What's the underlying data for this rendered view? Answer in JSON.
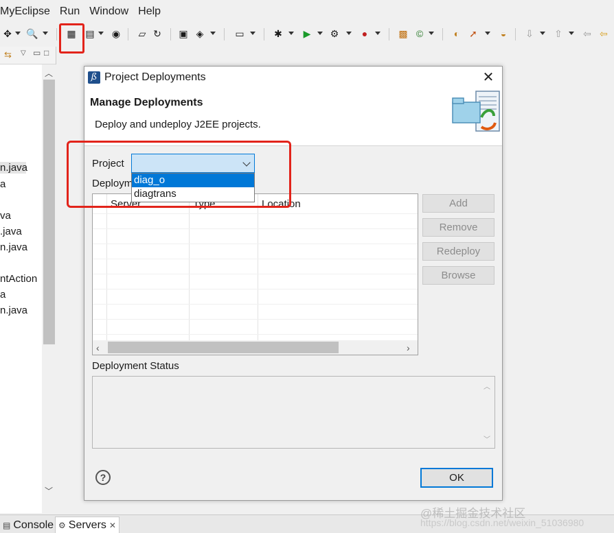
{
  "menubar": {
    "items": [
      "MyEclipse",
      "Run",
      "Window",
      "Help"
    ]
  },
  "left_panel": {
    "items": [
      "n.java",
      "a",
      "va",
      ".java",
      "n.java",
      "ntAction",
      "a",
      "n.java"
    ]
  },
  "bottom_tabs": {
    "console": "Console",
    "servers": "Servers"
  },
  "dialog": {
    "title": "Project Deployments",
    "header_title": "Manage Deployments",
    "header_desc": "Deploy and undeploy J2EE projects.",
    "project_label": "Project",
    "project_options": [
      "diag_o",
      "diagtrans"
    ],
    "project_selected_index": 0,
    "deployments_label": "Deploym",
    "table_columns": [
      "Server",
      "Type",
      "Location"
    ],
    "buttons": {
      "add": "Add",
      "remove": "Remove",
      "redeploy": "Redeploy",
      "browse": "Browse"
    },
    "status_label": "Deployment Status",
    "ok": "OK"
  },
  "watermark": "@稀土掘金技术社区",
  "watermark2": "https://blog.csdn.net/weixin_51036980",
  "colors": {
    "highlight": "#e2231a",
    "accent": "#0078d7",
    "combo_bg": "#cce4f7"
  }
}
